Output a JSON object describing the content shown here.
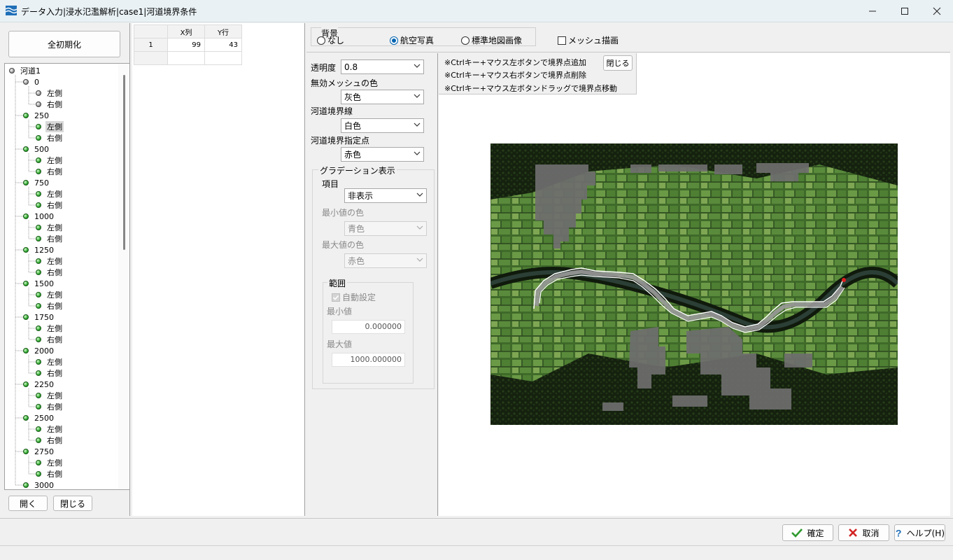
{
  "window": {
    "title": "データ入力|浸水氾濫解析|case1|河道境界条件",
    "icon": "app-wave-icon",
    "controls": [
      "minimize-icon",
      "maximize-icon",
      "close-icon"
    ]
  },
  "left": {
    "init_label": "全初期化",
    "open_label": "開く",
    "close_label": "閉じる"
  },
  "tree": {
    "root": "河道1",
    "nodes": [
      {
        "label": "0",
        "left": "左側",
        "right": "右側"
      },
      {
        "label": "250",
        "left": "左側",
        "right": "右側"
      },
      {
        "label": "500",
        "left": "左側",
        "right": "右側"
      },
      {
        "label": "750",
        "left": "左側",
        "right": "右側"
      },
      {
        "label": "1000",
        "left": "左側",
        "right": "右側"
      },
      {
        "label": "1250",
        "left": "左側",
        "right": "右側"
      },
      {
        "label": "1500",
        "left": "左側",
        "right": "右側"
      },
      {
        "label": "1750",
        "left": "左側",
        "right": "右側"
      },
      {
        "label": "2000",
        "left": "左側",
        "right": "右側"
      },
      {
        "label": "2250",
        "left": "左側",
        "right": "右側"
      },
      {
        "label": "2500",
        "left": "左側",
        "right": "右側"
      },
      {
        "label": "2750",
        "left": "左側",
        "right": "右側"
      },
      {
        "label": "3000"
      }
    ],
    "selected": "250-左側"
  },
  "grid": {
    "headers": [
      "X列",
      "Y行"
    ],
    "rows": [
      {
        "index": "1",
        "x": "99",
        "y": "43"
      }
    ]
  },
  "background": {
    "label": "背景",
    "options": [
      "なし",
      "航空写真",
      "標準地図画像"
    ],
    "selected": "航空写真",
    "mesh_label": "メッシュ描画",
    "mesh_checked": false
  },
  "settings": {
    "opacity_label": "透明度",
    "opacity_value": "0.8",
    "invalid_mesh_label": "無効メッシュの色",
    "invalid_mesh_value": "灰色",
    "boundary_line_label": "河道境界線",
    "boundary_line_value": "白色",
    "boundary_point_label": "河道境界指定点",
    "boundary_point_value": "赤色",
    "gradation": {
      "title": "グラデーション表示",
      "item_label": "項目",
      "item_value": "非表示",
      "min_color_label": "最小値の色",
      "min_color_value": "青色",
      "max_color_label": "最大値の色",
      "max_color_value": "赤色",
      "range": {
        "title": "範囲",
        "auto_label": "自動設定",
        "auto_checked": true,
        "min_label": "最小値",
        "min_value": "0.000000",
        "max_label": "最大値",
        "max_value": "1000.000000"
      }
    }
  },
  "hints": {
    "lines": [
      "※Ctrlキー+マウス左ボタンで境界点追加",
      "※Ctrlキー+マウス右ボタンで境界点削除",
      "※Ctrlキー+マウス左ボタンドラッグで境界点移動"
    ],
    "close_label": "閉じる"
  },
  "colors": {
    "accent": "#0063b1",
    "map_dark": "#1c2a16",
    "field_green": "#5e8a3a",
    "invalid_gray": "#6e6e6e",
    "boundary_white": "#ffffff",
    "point_red": "#e02020"
  },
  "footer": {
    "ok_label": "確定",
    "cancel_label": "取消",
    "help_label": "ヘルプ(H)"
  }
}
